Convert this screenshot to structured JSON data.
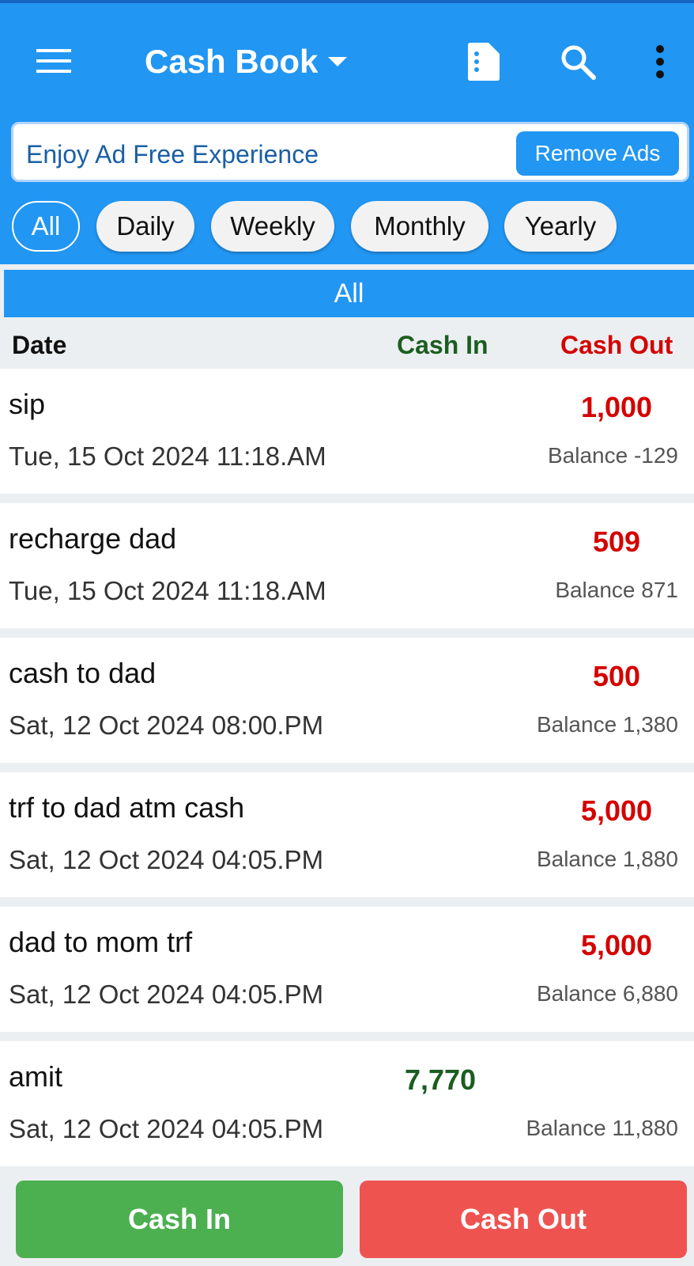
{
  "app": {
    "title": "Cash Book",
    "colors": {
      "primary": "#2196f3",
      "cash_in": "#1b5e20",
      "cash_out": "#d50000",
      "cash_in_button": "#4caf50",
      "cash_out_button": "#ef5350"
    },
    "icons": [
      "menu-icon",
      "dropdown-caret-icon",
      "document-icon",
      "search-icon",
      "more-vert-icon"
    ]
  },
  "ad": {
    "text": "Enjoy Ad Free Experience",
    "button": "Remove Ads"
  },
  "filters": [
    "All",
    "Daily",
    "Weekly",
    "Monthly",
    "Yearly"
  ],
  "selected_filter": "All",
  "section_label": "All",
  "columns": {
    "date": "Date",
    "cash_in": "Cash In",
    "cash_out": "Cash Out"
  },
  "entries": [
    {
      "name": "sip",
      "date": "Tue, 15 Oct 2024 11:18.AM",
      "cash_in": "",
      "cash_out": "1,000",
      "balance": "Balance -129"
    },
    {
      "name": "recharge dad",
      "date": "Tue, 15 Oct 2024 11:18.AM",
      "cash_in": "",
      "cash_out": "509",
      "balance": "Balance 871"
    },
    {
      "name": "cash to dad",
      "date": "Sat, 12 Oct 2024 08:00.PM",
      "cash_in": "",
      "cash_out": "500",
      "balance": "Balance 1,380"
    },
    {
      "name": "trf to dad atm cash",
      "date": "Sat, 12 Oct 2024 04:05.PM",
      "cash_in": "",
      "cash_out": "5,000",
      "balance": "Balance 1,880"
    },
    {
      "name": "dad to mom trf",
      "date": "Sat, 12 Oct 2024 04:05.PM",
      "cash_in": "",
      "cash_out": "5,000",
      "balance": "Balance 6,880"
    },
    {
      "name": "amit",
      "date": "Sat, 12 Oct 2024 04:05.PM",
      "cash_in": "7,770",
      "cash_out": "",
      "balance": "Balance 11,880"
    }
  ],
  "actions": {
    "cash_in": "Cash In",
    "cash_out": "Cash Out"
  }
}
